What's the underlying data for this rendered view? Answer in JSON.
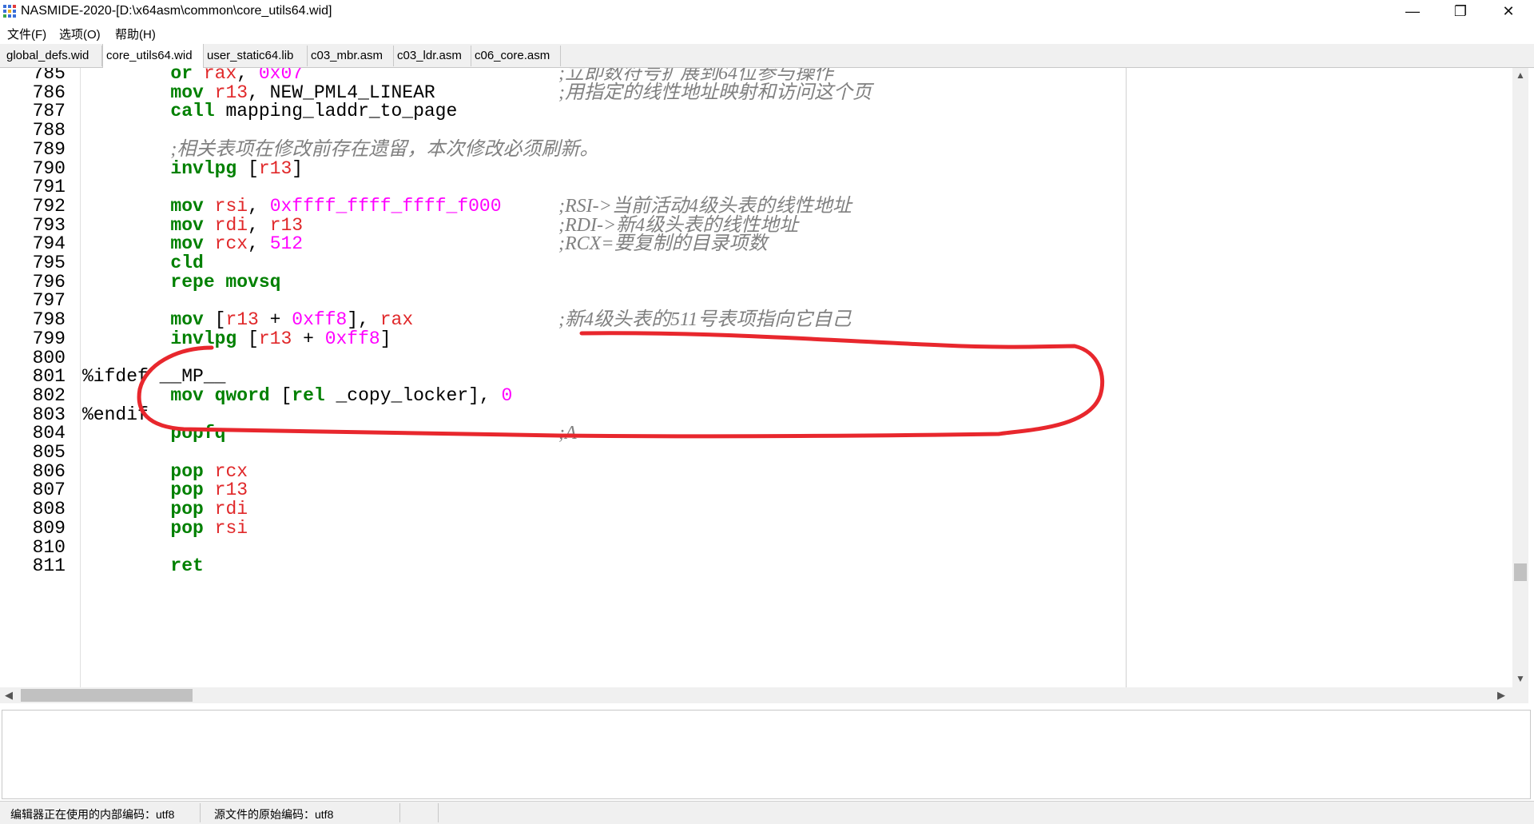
{
  "window": {
    "title": "NASMIDE-2020-[D:\\x64asm\\common\\core_utils64.wid]",
    "app_icon": "grid-app-icon",
    "controls": {
      "minimize": "—",
      "maximize": "❐",
      "close": "✕"
    }
  },
  "menu": {
    "file": "文件(F)",
    "options": "选项(O)",
    "help": "帮助(H)"
  },
  "tabs": [
    {
      "label": "global_defs.wid",
      "active": false
    },
    {
      "label": "core_utils64.wid",
      "active": true
    },
    {
      "label": "user_static64.lib",
      "active": false
    },
    {
      "label": "c03_mbr.asm",
      "active": false
    },
    {
      "label": "c03_ldr.asm",
      "active": false
    },
    {
      "label": "c06_core.asm",
      "active": false
    }
  ],
  "editor": {
    "lines": [
      {
        "no": "785",
        "indent": "        ",
        "tokens": [
          [
            "kw",
            "or"
          ],
          [
            "txt",
            " "
          ],
          [
            "reg",
            "rax"
          ],
          [
            "txt",
            ", "
          ],
          [
            "num",
            "0x07"
          ]
        ],
        "comment": ";立即数符号扩展到64位参与操作"
      },
      {
        "no": "786",
        "indent": "        ",
        "tokens": [
          [
            "kw",
            "mov"
          ],
          [
            "txt",
            " "
          ],
          [
            "reg",
            "r13"
          ],
          [
            "txt",
            ", NEW_PML4_LINEAR"
          ]
        ],
        "comment": ";用指定的线性地址映射和访问这个页"
      },
      {
        "no": "787",
        "indent": "        ",
        "tokens": [
          [
            "kw",
            "call"
          ],
          [
            "txt",
            " mapping_laddr_to_page"
          ]
        ],
        "comment": ""
      },
      {
        "no": "788",
        "indent": "",
        "tokens": [],
        "comment": ""
      },
      {
        "no": "789",
        "indent": "        ",
        "tokens": [],
        "comment": "",
        "inline_comment": ";相关表项在修改前存在遗留，本次修改必须刷新。"
      },
      {
        "no": "790",
        "indent": "        ",
        "tokens": [
          [
            "kw",
            "invlpg"
          ],
          [
            "txt",
            " ["
          ],
          [
            "reg",
            "r13"
          ],
          [
            "txt",
            "]"
          ]
        ],
        "comment": ""
      },
      {
        "no": "791",
        "indent": "",
        "tokens": [],
        "comment": ""
      },
      {
        "no": "792",
        "indent": "        ",
        "tokens": [
          [
            "kw",
            "mov"
          ],
          [
            "txt",
            " "
          ],
          [
            "reg",
            "rsi"
          ],
          [
            "txt",
            ", "
          ],
          [
            "num",
            "0xffff_ffff_ffff_f000"
          ]
        ],
        "comment": ";RSI->当前活动4级头表的线性地址"
      },
      {
        "no": "793",
        "indent": "        ",
        "tokens": [
          [
            "kw",
            "mov"
          ],
          [
            "txt",
            " "
          ],
          [
            "reg",
            "rdi"
          ],
          [
            "txt",
            ", "
          ],
          [
            "reg",
            "r13"
          ]
        ],
        "comment": ";RDI->新4级头表的线性地址"
      },
      {
        "no": "794",
        "indent": "        ",
        "tokens": [
          [
            "kw",
            "mov"
          ],
          [
            "txt",
            " "
          ],
          [
            "reg",
            "rcx"
          ],
          [
            "txt",
            ", "
          ],
          [
            "num",
            "512"
          ]
        ],
        "comment": ";RCX=要复制的目录项数"
      },
      {
        "no": "795",
        "indent": "        ",
        "tokens": [
          [
            "kw",
            "cld"
          ]
        ],
        "comment": ""
      },
      {
        "no": "796",
        "indent": "        ",
        "tokens": [
          [
            "kw",
            "repe movsq"
          ]
        ],
        "comment": ""
      },
      {
        "no": "797",
        "indent": "",
        "tokens": [],
        "comment": ""
      },
      {
        "no": "798",
        "indent": "        ",
        "tokens": [
          [
            "kw",
            "mov"
          ],
          [
            "txt",
            " ["
          ],
          [
            "reg",
            "r13"
          ],
          [
            "txt",
            " + "
          ],
          [
            "num",
            "0xff8"
          ],
          [
            "txt",
            "], "
          ],
          [
            "reg",
            "rax"
          ]
        ],
        "comment": ";新4级头表的511号表项指向它自己"
      },
      {
        "no": "799",
        "indent": "        ",
        "tokens": [
          [
            "kw",
            "invlpg"
          ],
          [
            "txt",
            " ["
          ],
          [
            "reg",
            "r13"
          ],
          [
            "txt",
            " + "
          ],
          [
            "num",
            "0xff8"
          ],
          [
            "txt",
            "]"
          ]
        ],
        "comment": ""
      },
      {
        "no": "800",
        "indent": "",
        "tokens": [],
        "comment": ""
      },
      {
        "no": "801",
        "indent": "",
        "tokens": [
          [
            "pp",
            "%ifdef __MP__"
          ]
        ],
        "comment": ""
      },
      {
        "no": "802",
        "indent": "        ",
        "tokens": [
          [
            "kw",
            "mov"
          ],
          [
            "txt",
            " "
          ],
          [
            "kw",
            "qword"
          ],
          [
            "txt",
            " ["
          ],
          [
            "kw",
            "rel"
          ],
          [
            "txt",
            " _copy_locker], "
          ],
          [
            "num",
            "0"
          ]
        ],
        "comment": ""
      },
      {
        "no": "803",
        "indent": "",
        "tokens": [
          [
            "pp",
            "%endif"
          ]
        ],
        "comment": ""
      },
      {
        "no": "804",
        "indent": "        ",
        "tokens": [
          [
            "kw",
            "popfq"
          ]
        ],
        "comment": ";A"
      },
      {
        "no": "805",
        "indent": "",
        "tokens": [],
        "comment": ""
      },
      {
        "no": "806",
        "indent": "        ",
        "tokens": [
          [
            "kw",
            "pop"
          ],
          [
            "txt",
            " "
          ],
          [
            "reg",
            "rcx"
          ]
        ],
        "comment": ""
      },
      {
        "no": "807",
        "indent": "        ",
        "tokens": [
          [
            "kw",
            "pop"
          ],
          [
            "txt",
            " "
          ],
          [
            "reg",
            "r13"
          ]
        ],
        "comment": ""
      },
      {
        "no": "808",
        "indent": "        ",
        "tokens": [
          [
            "kw",
            "pop"
          ],
          [
            "txt",
            " "
          ],
          [
            "reg",
            "rdi"
          ]
        ],
        "comment": ""
      },
      {
        "no": "809",
        "indent": "        ",
        "tokens": [
          [
            "kw",
            "pop"
          ],
          [
            "txt",
            " "
          ],
          [
            "reg",
            "rsi"
          ]
        ],
        "comment": ""
      },
      {
        "no": "810",
        "indent": "",
        "tokens": [],
        "comment": ""
      },
      {
        "no": "811",
        "indent": "        ",
        "tokens": [
          [
            "kw",
            "ret"
          ]
        ],
        "comment": ""
      }
    ],
    "annotation_color": "#e8272d"
  },
  "status": {
    "internal_encoding": "编辑器正在使用的内部编码：utf8",
    "source_encoding": "源文件的原始编码：utf8"
  },
  "colors": {
    "keyword": "#008000",
    "register": "#e0282a",
    "number": "#ff00ff",
    "comment": "#808080"
  }
}
